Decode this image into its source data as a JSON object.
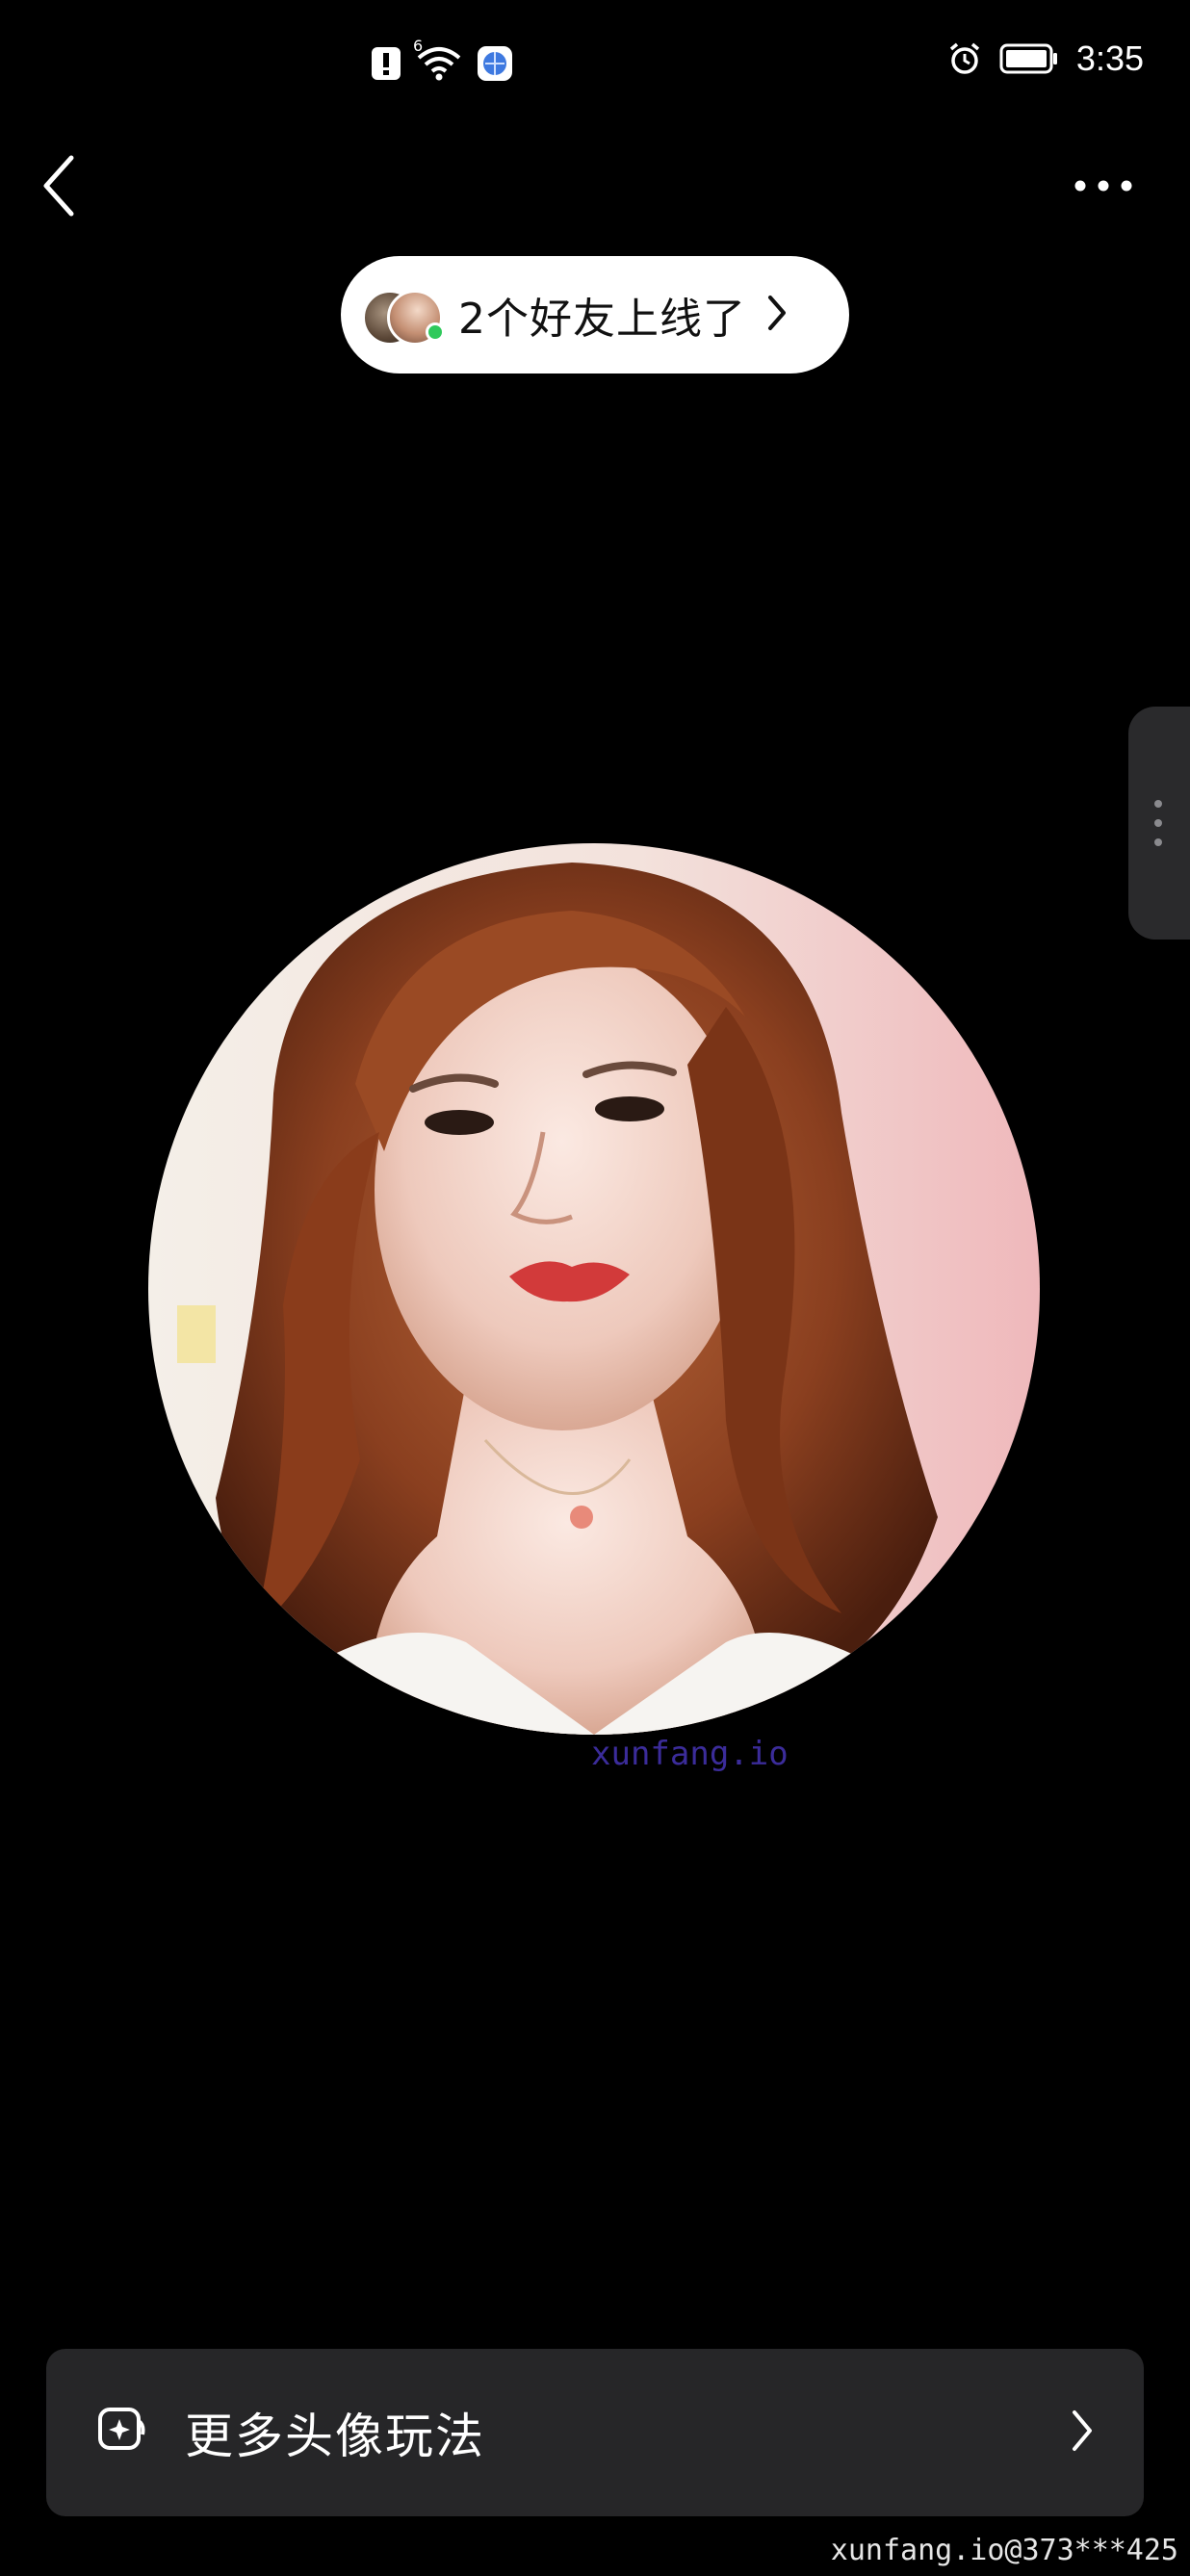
{
  "status_bar": {
    "time": "3:35",
    "network_label": "6",
    "icons": [
      "alert-icon",
      "wifi-icon",
      "browser-icon",
      "alarm-icon",
      "battery-icon"
    ]
  },
  "top_bar": {
    "back_icon": "chevron-left-icon",
    "more_icon": "more-horizontal-icon"
  },
  "friend_pill": {
    "text": "2个好友上线了",
    "chevron_icon": "chevron-right-icon"
  },
  "avatar": {
    "description_icon": "profile-photo"
  },
  "watermark_center": "xunfang.io",
  "more_avatar": {
    "label": "更多头像玩法",
    "icon": "sparkle-frame-icon",
    "chevron_icon": "chevron-right-icon"
  },
  "watermark_corner": "xunfang.io@373***425",
  "colors": {
    "background": "#000000",
    "pill_bg": "#ffffff",
    "bar_bg": "#262628",
    "online": "#2fc95b"
  }
}
